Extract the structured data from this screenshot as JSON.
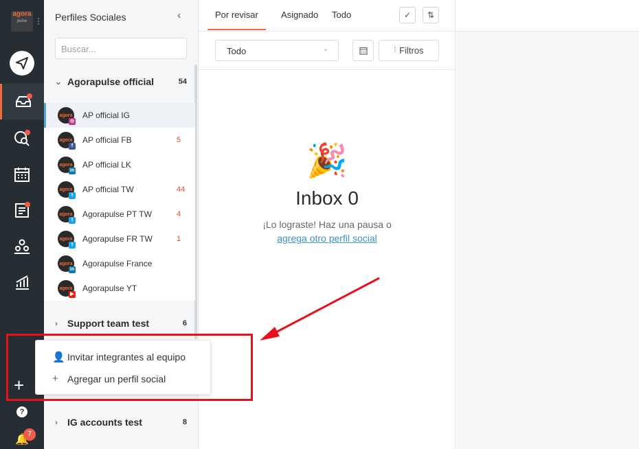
{
  "logo": {
    "text": "agora",
    "sub": "pulse"
  },
  "panel": {
    "title": "Perfiles Sociales",
    "search_placeholder": "Buscar..."
  },
  "groups": [
    {
      "name": "Agorapulse official",
      "count": "54"
    },
    {
      "name": "Support team test",
      "count": "6"
    },
    {
      "name": "IG accounts test",
      "count": "8"
    }
  ],
  "profiles": [
    {
      "name": "AP official IG",
      "count": "",
      "net": "instagram"
    },
    {
      "name": "AP official FB",
      "count": "5",
      "net": "facebook"
    },
    {
      "name": "AP official LK",
      "count": "",
      "net": "linkedin"
    },
    {
      "name": "AP official TW",
      "count": "44",
      "net": "twitter"
    },
    {
      "name": "Agorapulse PT TW",
      "count": "4",
      "net": "twitter"
    },
    {
      "name": "Agorapulse FR TW",
      "count": "1",
      "net": "twitter"
    },
    {
      "name": "Agorapulse France",
      "count": "",
      "net": "linkedin"
    },
    {
      "name": "Agorapulse YT",
      "count": "",
      "net": "youtube"
    }
  ],
  "tabs": {
    "t1": "Por revisar",
    "t2": "Asignado",
    "t3": "Todo"
  },
  "filter": {
    "select": "Todo",
    "filters": "Filtros"
  },
  "empty": {
    "title": "Inbox 0",
    "line1": "¡Lo lograste! Haz una pausa o",
    "link": "agrega otro perfil social"
  },
  "popup": {
    "invite": "Invitar integrantes al equipo",
    "add": "Agregar un perfil social"
  },
  "notifications": {
    "count": "7"
  },
  "colors": {
    "accent": "#f26b3a",
    "annotation": "#e8111b",
    "link": "#3b8fc4"
  }
}
